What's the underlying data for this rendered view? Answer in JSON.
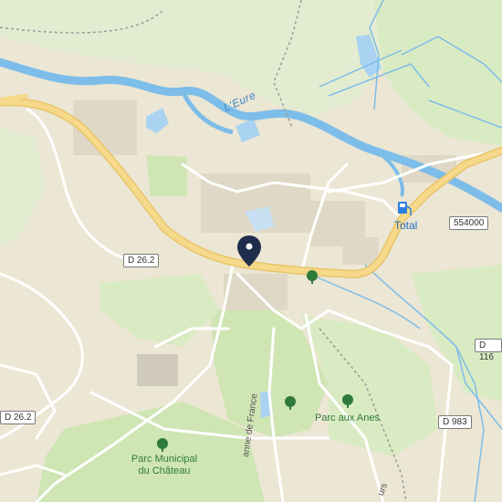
{
  "map": {
    "colors": {
      "land": "#ece6d4",
      "park": "#cfe5b4",
      "meadow": "#d9ebc2",
      "water": "#a9d3f0",
      "river_line": "#7dbde9",
      "main_road": "#f6d98a",
      "main_road_casing": "#e8c56a",
      "minor_road": "#ffffff",
      "building": "#dfd8c6",
      "marker": "#1f2d4d",
      "fuel": "#2a7de1",
      "tree": "#2f7a3a"
    },
    "labels": {
      "river": "L'Eure",
      "station": "Total",
      "park_1": "Parc aux Anes",
      "park_2_line1": "Parc Municipal",
      "park_2_line2": "du Château",
      "street_1": "anne de France",
      "street_2": "urs"
    },
    "road_shields": {
      "d262_a": "D 26.2",
      "d262_b": "D 26.2",
      "r554000": "554000",
      "d116": "D 116",
      "d983": "D 983"
    },
    "icons": {
      "location_marker": "map-pin-icon",
      "fuel_station": "fuel-pump-icon",
      "tree": "tree-icon"
    }
  }
}
